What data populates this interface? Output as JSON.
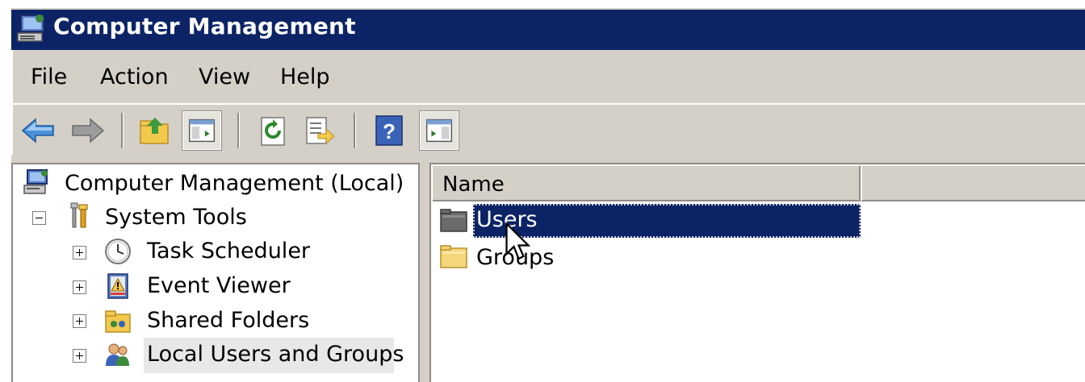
{
  "window": {
    "title": "Computer Management",
    "title_bar_color": "#0c2466",
    "app_icon": "computer-management-icon"
  },
  "menu": {
    "items": [
      "File",
      "Action",
      "View",
      "Help"
    ]
  },
  "toolbar": {
    "buttons": [
      {
        "name": "back-button",
        "icon": "back-arrow-icon"
      },
      {
        "name": "forward-button",
        "icon": "forward-arrow-icon"
      },
      {
        "name": "up-one-level-button",
        "icon": "folder-up-icon"
      },
      {
        "name": "show-hide-console-tree-button",
        "icon": "console-tree-icon",
        "pressed": true
      },
      {
        "name": "refresh-button",
        "icon": "refresh-icon"
      },
      {
        "name": "export-list-button",
        "icon": "export-list-icon"
      },
      {
        "name": "help-button",
        "icon": "help-icon"
      },
      {
        "name": "show-hide-action-pane-button",
        "icon": "action-pane-icon",
        "pressed": true
      }
    ]
  },
  "tree": {
    "root": "Computer Management (Local)",
    "system_tools": "System Tools",
    "items": [
      {
        "label": "Task Scheduler",
        "icon": "clock-icon"
      },
      {
        "label": "Event Viewer",
        "icon": "event-viewer-icon"
      },
      {
        "label": "Shared Folders",
        "icon": "shared-folders-icon"
      },
      {
        "label": "Local Users and Groups",
        "icon": "users-groups-icon",
        "selected": true
      }
    ]
  },
  "list": {
    "columns": [
      "Name",
      ""
    ],
    "rows": [
      {
        "label": "Users",
        "icon": "folder-dark-icon",
        "selected": true
      },
      {
        "label": "Groups",
        "icon": "folder-icon",
        "selected": false
      }
    ]
  }
}
